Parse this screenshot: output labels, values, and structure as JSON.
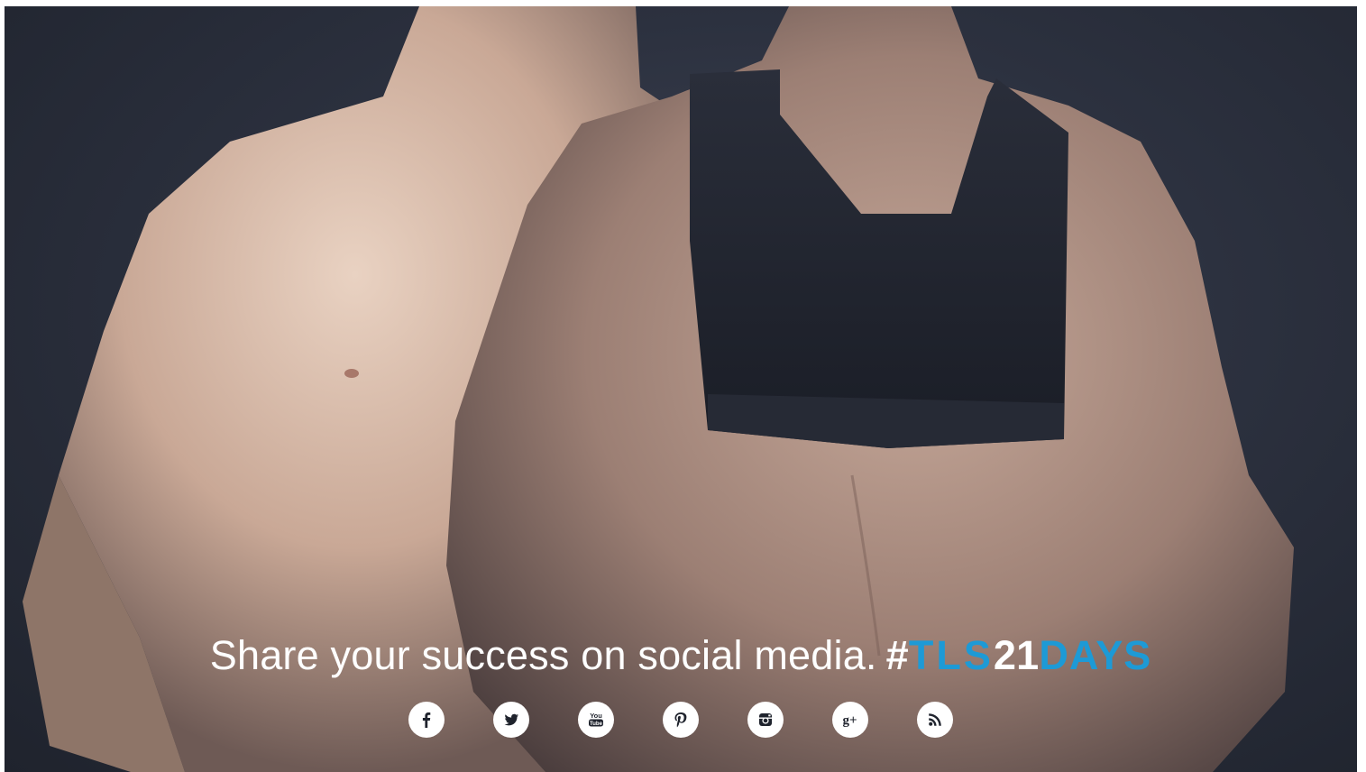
{
  "headline": {
    "text": "Share your success on social media.",
    "hash": "#",
    "tag_tls": "TLS",
    "tag_num": "21",
    "tag_days": "DAYS"
  },
  "colors": {
    "headline_white": "#ffffff",
    "accent_blue": "#1d9ad6",
    "icon_glyph": "#1f232d",
    "background": "#2c313f"
  },
  "social_icons": [
    {
      "name": "facebook-icon"
    },
    {
      "name": "twitter-icon"
    },
    {
      "name": "youtube-icon",
      "glyph_text_top": "You",
      "glyph_text_bottom": "Tube"
    },
    {
      "name": "pinterest-icon"
    },
    {
      "name": "instagram-icon"
    },
    {
      "name": "google-plus-icon",
      "glyph_text": "g+"
    },
    {
      "name": "rss-icon"
    }
  ]
}
